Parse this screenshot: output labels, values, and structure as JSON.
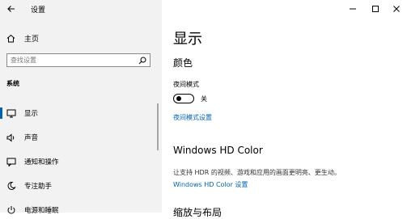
{
  "window": {
    "title": "设置",
    "controls": {
      "minimize": "minimize-icon",
      "maximize": "maximize-icon",
      "close": "close-icon"
    }
  },
  "sidebar": {
    "home_label": "主页",
    "search_placeholder": "查找设置",
    "section_header": "系统",
    "items": [
      {
        "label": "显示",
        "icon": "monitor-icon",
        "active": true
      },
      {
        "label": "声音",
        "icon": "speaker-icon",
        "active": false
      },
      {
        "label": "通知和操作",
        "icon": "notification-icon",
        "active": false
      },
      {
        "label": "专注助手",
        "icon": "moon-icon",
        "active": false
      },
      {
        "label": "电源和睡眠",
        "icon": "power-icon",
        "active": false
      }
    ]
  },
  "main": {
    "title": "显示",
    "color_section": {
      "heading": "颜色",
      "night_mode_label": "夜间模式",
      "toggle_state": "关",
      "night_mode_link": "夜间模式设置"
    },
    "hd_section": {
      "heading": "Windows HD Color",
      "description": "让支持 HDR 的视频、游戏和应用的画面更明亮、更生动。",
      "link": "Windows HD Color 设置"
    },
    "next_section_partial": "缩放与布局"
  },
  "colors": {
    "accent": "#0063b1",
    "sidebar_bg": "#f2f2f2",
    "main_bg": "#ffffff"
  }
}
